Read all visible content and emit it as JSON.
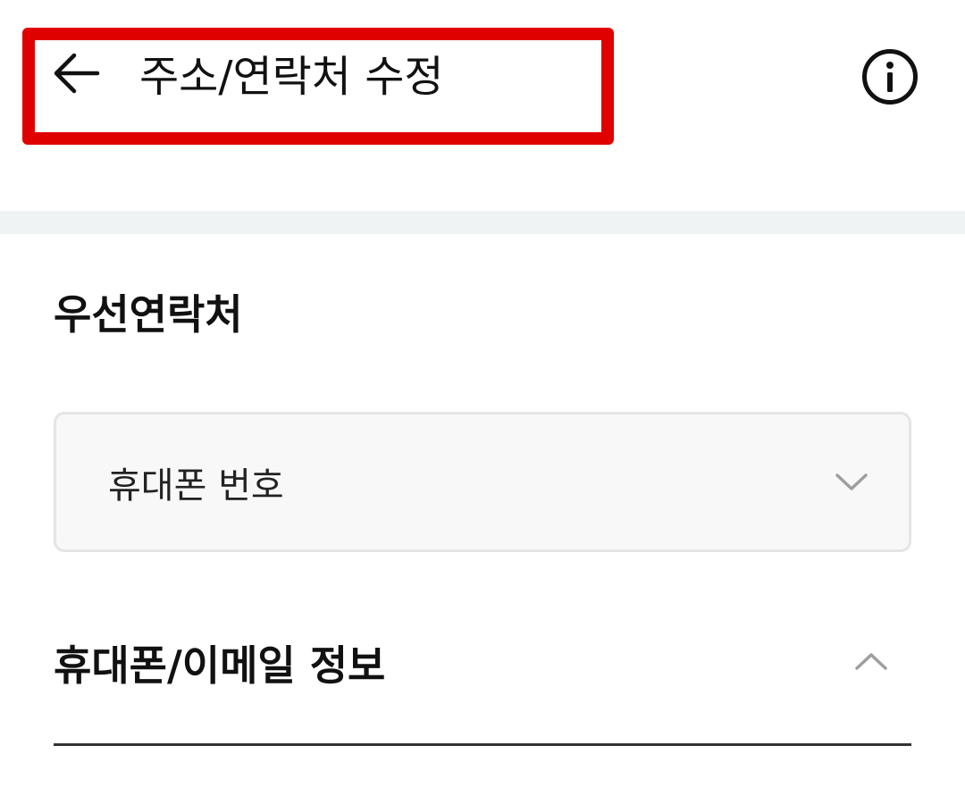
{
  "header": {
    "title": "주소/연락처 수정",
    "back_icon": "arrow-left-icon",
    "info_icon": "info-circle-icon",
    "highlight_color": "#e00000"
  },
  "preferred_contact": {
    "section_title": "우선연락처",
    "select": {
      "selected_value": "휴대폰 번호",
      "icon": "chevron-down-icon"
    }
  },
  "phone_email_info": {
    "section_title": "휴대폰/이메일 정보",
    "toggle_icon": "chevron-up-icon",
    "expanded": true
  },
  "colors": {
    "divider_band": "#f0f3f4",
    "select_background": "#f8f8f8",
    "select_border": "#e5e5e5",
    "chevron": "#9e9e9e",
    "text": "#111111"
  }
}
